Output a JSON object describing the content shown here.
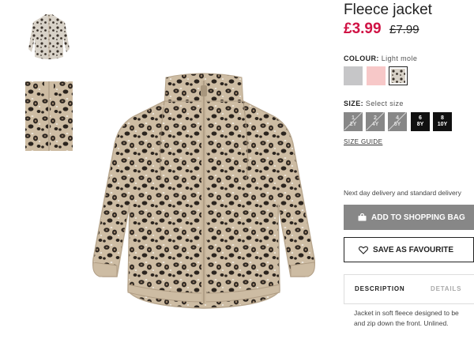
{
  "product": {
    "title": "Fleece jacket",
    "price_now": "£3.99",
    "price_was": "£7.99"
  },
  "colour": {
    "label": "COLOUR:",
    "value": "Light mole",
    "swatches": [
      {
        "name": "grey",
        "color": "#c6c6c8"
      },
      {
        "name": "light pink",
        "color": "#f7c8c8"
      },
      {
        "name": "light mole leopard",
        "color": "#b8a58c",
        "selected": true
      }
    ]
  },
  "size": {
    "label": "SIZE:",
    "value": "Select size",
    "options": [
      {
        "l1": "1",
        "l2": "2Y",
        "available": false
      },
      {
        "l1": "2",
        "l2": "4Y",
        "available": false
      },
      {
        "l1": "4",
        "l2": "6Y",
        "available": false
      },
      {
        "l1": "6",
        "l2": "8Y",
        "available": true
      },
      {
        "l1": "8",
        "l2": "10Y",
        "available": true
      }
    ],
    "guide": "SIZE GUIDE"
  },
  "delivery": "Next day delivery and standard delivery",
  "buttons": {
    "add_to_bag": "ADD TO SHOPPING BAG",
    "favourite": "SAVE AS FAVOURITE"
  },
  "tabs": {
    "description": "DESCRIPTION",
    "details": "DETAILS"
  },
  "description_text": {
    "line1": "Jacket in soft fleece designed to be",
    "line2": "and zip down the front. Unlined."
  },
  "colors": {
    "price_red": "#d01345",
    "button_grey": "#878787",
    "leopard_base": "#cdbca3",
    "leopard_spot": "#2b241e"
  }
}
